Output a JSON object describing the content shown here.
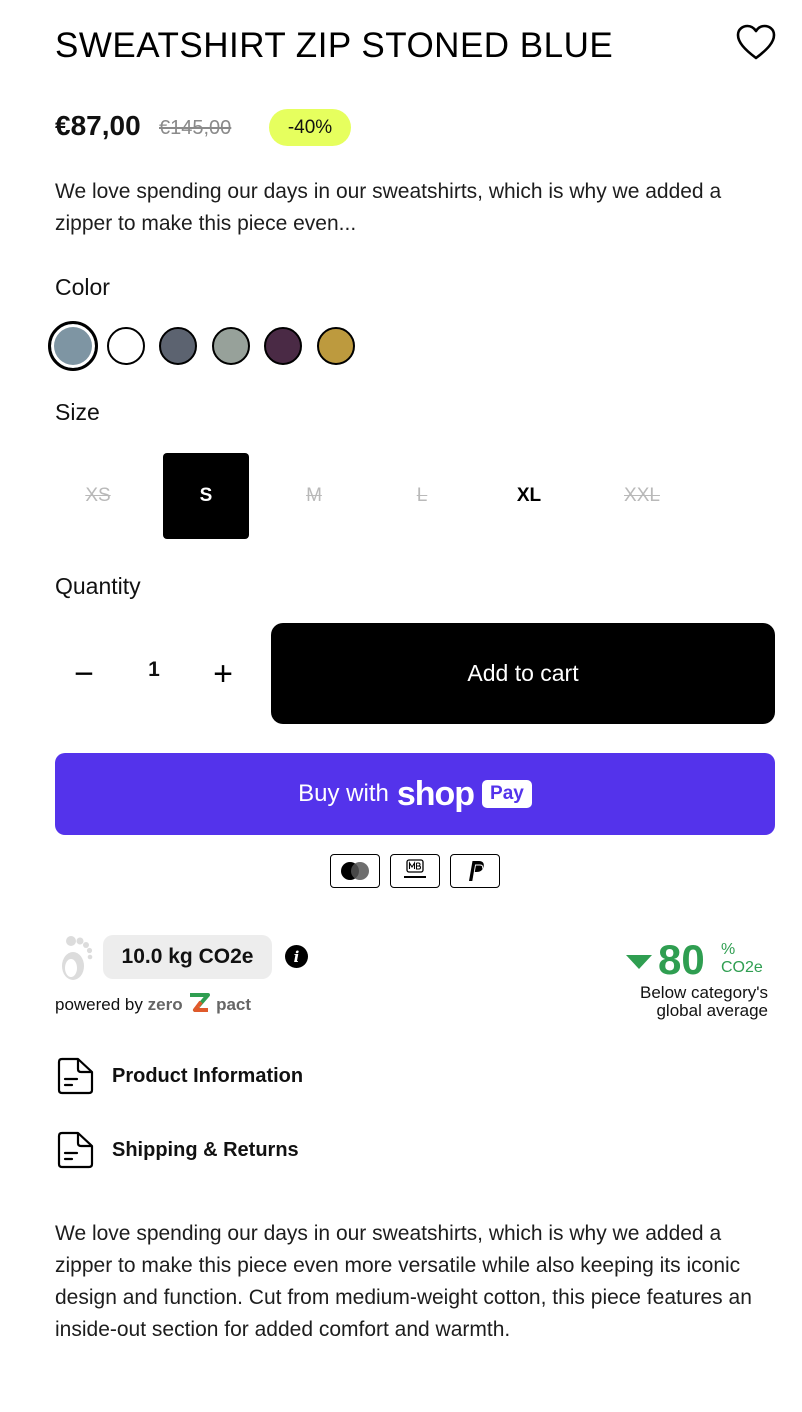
{
  "product": {
    "title": "SWEATSHIRT ZIP STONED BLUE",
    "price": "€87,00",
    "compare_price": "€145,00",
    "discount_badge": "-40%",
    "short_description": "We love spending our days in our sweatshirts, which is why we added a zipper to make this piece even...",
    "long_description": "We love spending our days in our sweatshirts, which is why we added a zipper to make this piece even more versatile while also keeping its iconic design and function. Cut from medium-weight cotton, this piece features an inside-out section for added comfort and warmth."
  },
  "color": {
    "label": "Color",
    "swatches": [
      "#7e95a3",
      "#ffffff",
      "#5c6370",
      "#97a19a",
      "#4a2a45",
      "#bd9a3e"
    ],
    "selected_index": 0
  },
  "size": {
    "label": "Size",
    "options": [
      {
        "label": "XS",
        "state": "unavailable"
      },
      {
        "label": "S",
        "state": "selected"
      },
      {
        "label": "M",
        "state": "unavailable"
      },
      {
        "label": "L",
        "state": "unavailable"
      },
      {
        "label": "XL",
        "state": "available"
      },
      {
        "label": "XXL",
        "state": "unavailable"
      }
    ]
  },
  "quantity": {
    "label": "Quantity",
    "value": "1",
    "minus": "−",
    "plus": "+"
  },
  "buttons": {
    "add_to_cart": "Add to cart",
    "buy_with": "Buy with",
    "shop_word": "shop",
    "pay_word": "Pay"
  },
  "payment_methods": [
    "mastercard-icon",
    "multibanco-icon",
    "paypal-icon"
  ],
  "carbon": {
    "value": "10.0 kg CO2e",
    "info_glyph": "i",
    "powered_by": "powered by",
    "brand": "zero",
    "brand_mark": "Z",
    "brand_suffix": "pact",
    "percent": "80",
    "percent_unit": "%",
    "co2_unit": "CO2e",
    "below_text_1": "Below category's",
    "below_text_2": "global average",
    "accent_color": "#2f9e51"
  },
  "accordions": [
    {
      "label": "Product Information"
    },
    {
      "label": "Shipping & Returns"
    }
  ],
  "colors": {
    "shop_pay": "#5433eb",
    "badge": "#e6ff5e"
  }
}
